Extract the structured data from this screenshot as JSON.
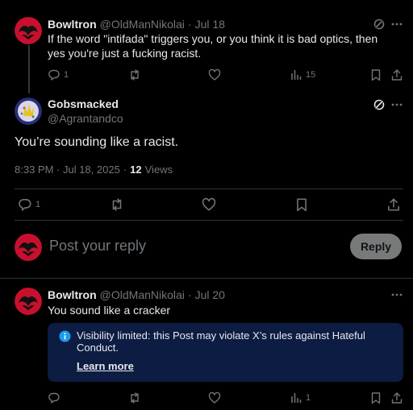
{
  "reply1": {
    "name": "Bowltron",
    "handle": "@OldManNikolai",
    "dot": "·",
    "date": "Jul 18",
    "text": "If the word \"intifada\" triggers you, or you think it is bad optics, then yes you're just a fucking racist.",
    "counts": {
      "replies": "1",
      "views": "15"
    }
  },
  "main_post": {
    "name": "Gobsmacked",
    "handle": "@Agrantandco",
    "text": "You’re sounding like a racist.",
    "timestamp": "8:33 PM · Jul 18, 2025",
    "dot": "·",
    "views_count": "12",
    "views_label": "Views",
    "counts": {
      "replies": "1"
    }
  },
  "composer": {
    "placeholder": "Post your reply",
    "button_label": "Reply"
  },
  "reply2": {
    "name": "Bowltron",
    "handle": "@OldManNikolai",
    "dot": "·",
    "date": "Jul 20",
    "text": "You sound like a cracker",
    "notice_text": "Visibility limited: this Post may violate X’s rules against Hateful Conduct.",
    "notice_link": "Learn more",
    "counts": {
      "views": "1"
    }
  },
  "icons": [
    "reply-icon",
    "repost-icon",
    "like-icon",
    "views-icon",
    "bookmark-icon",
    "share-icon",
    "grok-icon",
    "more-icon",
    "info-icon"
  ],
  "colors": {
    "background": "#000000",
    "text": "#e7e9ea",
    "muted": "#71767b",
    "notice_bg": "#0c1c43",
    "info_blue": "#1d9bf0",
    "avatar_red": "#c8102e"
  }
}
